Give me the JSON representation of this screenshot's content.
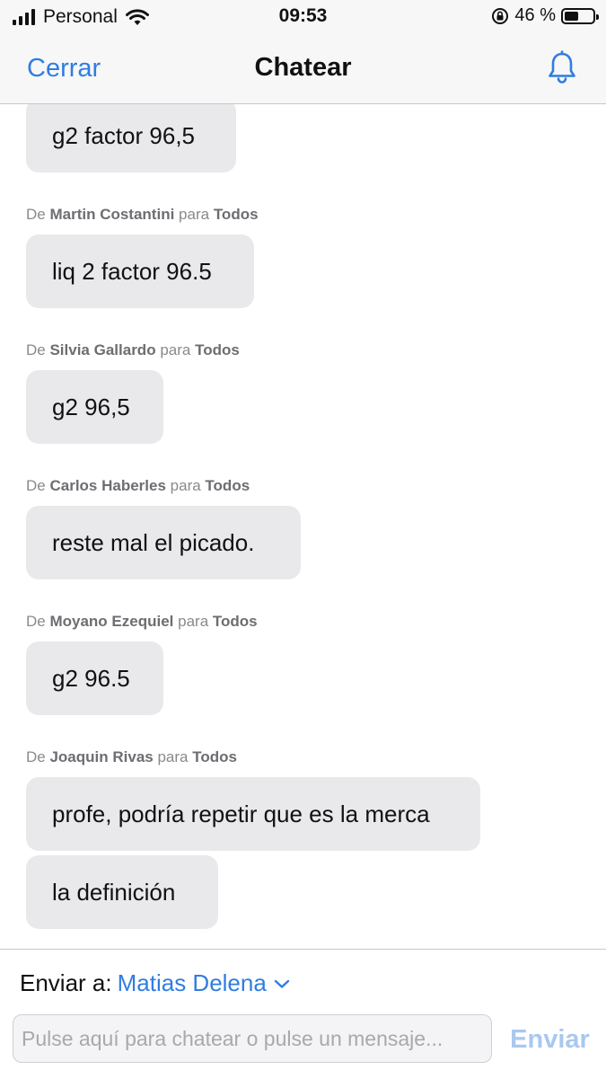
{
  "status_bar": {
    "carrier": "Personal",
    "time": "09:53",
    "battery_percent": "46 %",
    "battery_level": 0.44,
    "signal_bars": 4
  },
  "nav": {
    "close_label": "Cerrar",
    "title": "Chatear",
    "bell_icon": "bell-icon"
  },
  "messages": [
    {
      "from_prefix": "",
      "sender": "",
      "to_prefix": "",
      "recipient": "",
      "bubbles": [
        "g2 factor 96,5"
      ]
    },
    {
      "from_prefix": "De",
      "sender": "Martin Costantini",
      "to_prefix": "para",
      "recipient": "Todos",
      "bubbles": [
        "liq 2 factor 96.5"
      ]
    },
    {
      "from_prefix": "De",
      "sender": "Silvia Gallardo",
      "to_prefix": "para",
      "recipient": "Todos",
      "bubbles": [
        "g2 96,5"
      ]
    },
    {
      "from_prefix": "De",
      "sender": "Carlos Haberles",
      "to_prefix": "para",
      "recipient": "Todos",
      "bubbles": [
        "reste mal el picado."
      ]
    },
    {
      "from_prefix": "De",
      "sender": "Moyano Ezequiel",
      "to_prefix": "para",
      "recipient": "Todos",
      "bubbles": [
        "g2 96.5"
      ]
    },
    {
      "from_prefix": "De",
      "sender": "Joaquin Rivas",
      "to_prefix": "para",
      "recipient": "Todos",
      "bubbles": [
        "profe, podría repetir que es la merca",
        "la definición"
      ]
    }
  ],
  "compose": {
    "send_to_label": "Enviar a:",
    "recipient": "Matias Delena",
    "input_placeholder": "Pulse aquí para chatear o pulse un mensaje...",
    "input_value": "",
    "send_label": "Enviar"
  },
  "colors": {
    "accent": "#2f7de1",
    "send_disabled": "#a9c8ef",
    "bubble": "#e9e9eb"
  }
}
